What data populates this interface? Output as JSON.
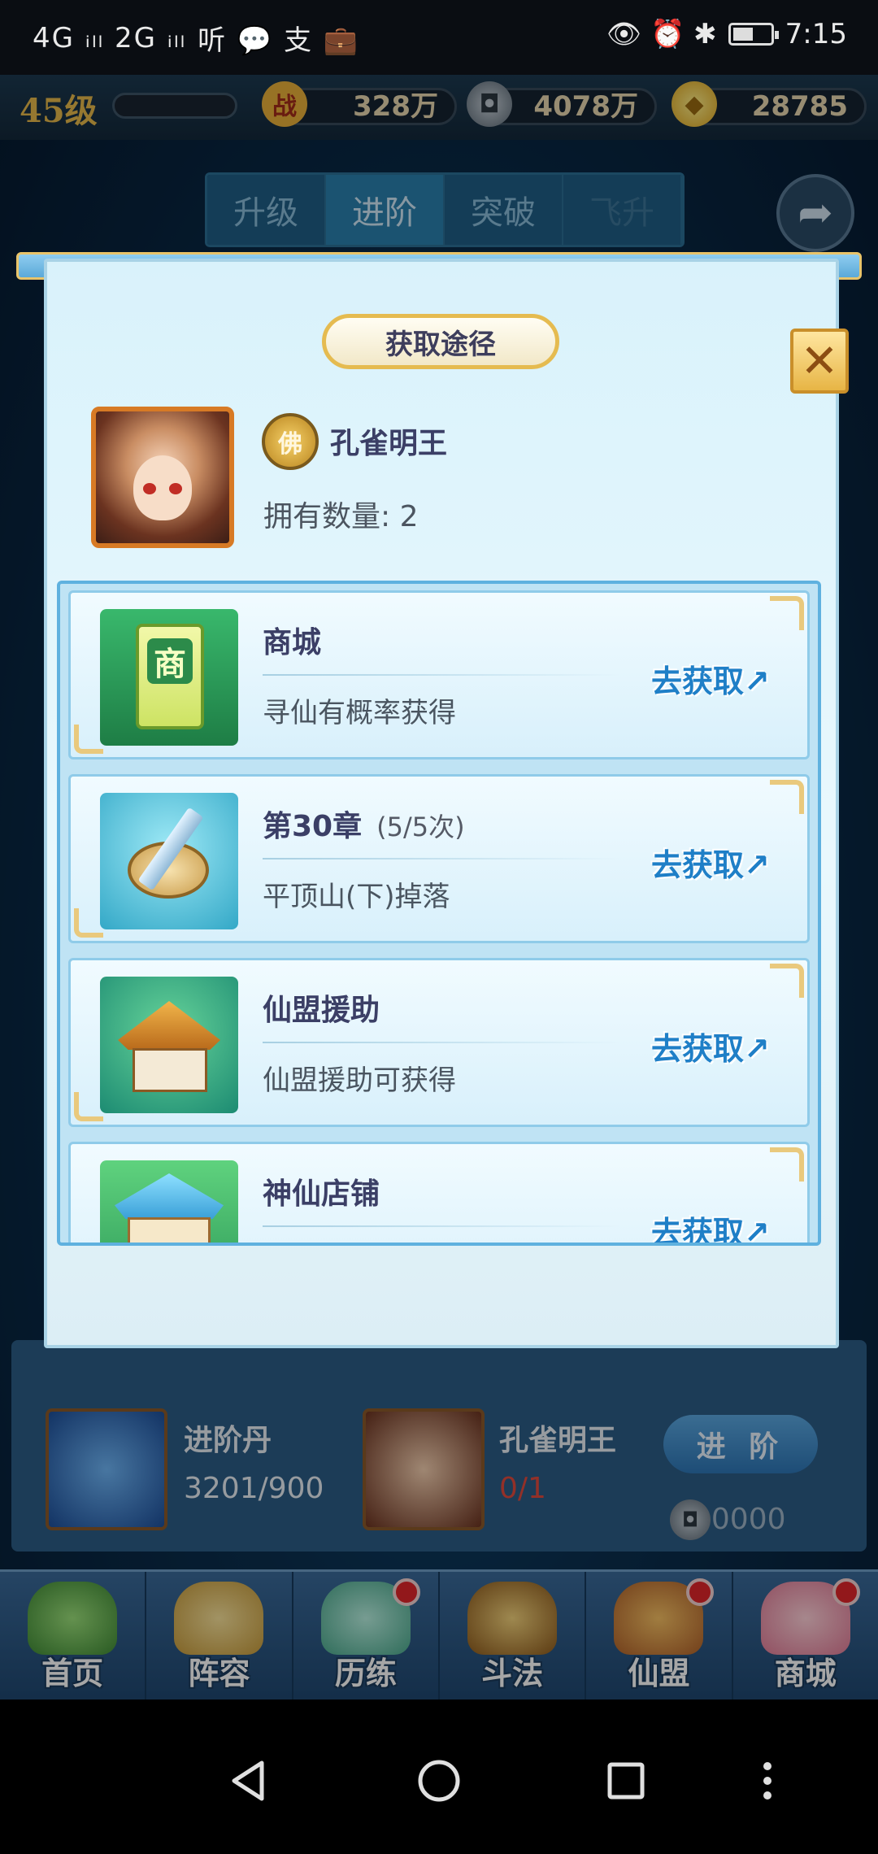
{
  "status_bar": {
    "network_left": "4G ᵢₗₗ 2G ᵢₗₗ",
    "app_icons": "听 💬 支 💼",
    "right_icons": "👁 ⏰ ✱",
    "time": "7:15",
    "battery_level": 0.55
  },
  "resources": {
    "level": "45级",
    "power_icon": "战",
    "power_value": "328万",
    "coin_value": "4078万",
    "gold_value": "28785"
  },
  "background_tabs": [
    "升级",
    "进阶",
    "突破",
    "飞升"
  ],
  "background_info": {
    "item_name": "进阶丹",
    "item_count": "3201/900",
    "hero_name": "孔雀明王",
    "hero_count": "0/1",
    "action_label": "进 阶",
    "cost": "90000"
  },
  "bottom_nav": [
    {
      "label": "首页",
      "badge": false
    },
    {
      "label": "阵容",
      "badge": false
    },
    {
      "label": "历练",
      "badge": true
    },
    {
      "label": "斗法",
      "badge": false
    },
    {
      "label": "仙盟",
      "badge": true
    },
    {
      "label": "商城",
      "badge": true
    }
  ],
  "modal": {
    "title": "获取途径",
    "close_symbol": "✕",
    "hero_badge": "佛",
    "hero_name": "孔雀明王",
    "owned_label": "拥有数量: 2",
    "go_label": "去获取↗",
    "sources": [
      {
        "title": "商城",
        "extra": "",
        "desc": "寻仙有概率获得",
        "icon": "shop-icon",
        "icon_text": "商"
      },
      {
        "title": "第30章",
        "extra": "(5/5次)",
        "desc": "平顶山(下)掉落",
        "icon": "sword-icon",
        "icon_text": ""
      },
      {
        "title": "仙盟援助",
        "extra": "",
        "desc": "仙盟援助可获得",
        "icon": "pavilion-icon",
        "icon_text": ""
      },
      {
        "title": "神仙店铺",
        "extra": "",
        "desc": "",
        "icon": "tower-icon",
        "icon_text": ""
      }
    ]
  }
}
